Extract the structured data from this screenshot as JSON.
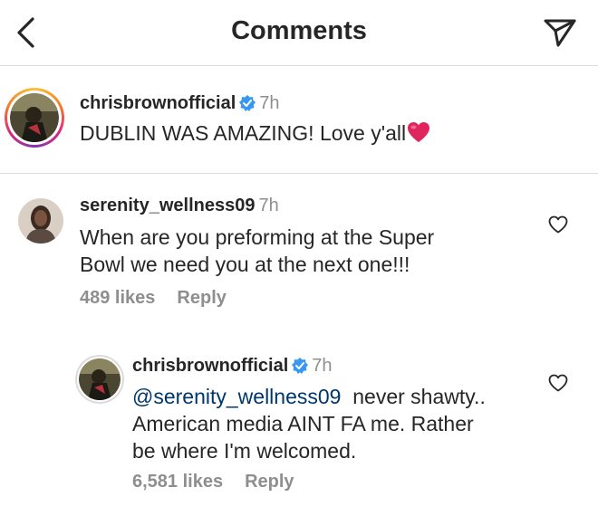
{
  "header": {
    "title": "Comments",
    "back_icon": "chevron-left-icon",
    "share_icon": "paper-plane-icon"
  },
  "caption": {
    "username": "chrisbrownofficial",
    "verified": true,
    "time": "7h",
    "text": "DUBLIN WAS AMAZING! Love y'all"
  },
  "comments": [
    {
      "username": "serenity_wellness09",
      "time": "7h",
      "line1": "When are you preforming at the Super",
      "line2": "Bowl we need you at the next one!!!",
      "likes": "489 likes",
      "reply_label": "Reply"
    }
  ],
  "reply": {
    "username": "chrisbrownofficial",
    "verified": true,
    "time": "7h",
    "mention": "@serenity_wellness09",
    "line1_rest": "never shawty..",
    "line2": "American media AINT FA me. Rather",
    "line3": "be where I'm welcomed.",
    "likes": "6,581 likes",
    "reply_label": "Reply"
  },
  "colors": {
    "text": "#262626",
    "muted": "#8e8e8e",
    "mention": "#00376b",
    "verified": "#3897f0",
    "heart_emoji": "#e0245e"
  }
}
